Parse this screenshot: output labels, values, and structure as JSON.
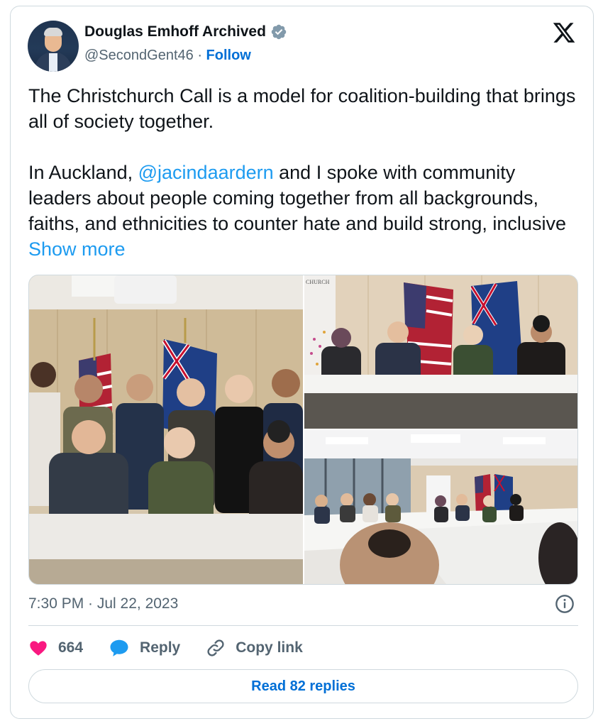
{
  "author": {
    "display_name": "Douglas Emhoff Archived",
    "handle": "@SecondGent46",
    "separator": "·",
    "follow_label": "Follow",
    "verified": true,
    "avatar": "profile-photo"
  },
  "brand_icon": "x-logo-icon",
  "tweet": {
    "paragraph_1": "The Christchurch Call is a model for coalition-building that brings all of society together.",
    "paragraph_2_before": "In Auckland, ",
    "mention": "@jacindaardern",
    "paragraph_2_after": " and I spoke with community leaders about people coming together from all backgrounds, faiths, and ethnicities to counter hate and build strong, inclusive ",
    "show_more": "Show more"
  },
  "media": {
    "photos": [
      {
        "kind": "group-photo"
      },
      {
        "kind": "panel-table-photo",
        "sign_text": "CHURCH"
      },
      {
        "kind": "conference-room-photo"
      }
    ]
  },
  "meta": {
    "timestamp": "7:30 PM · Jul 22, 2023",
    "info_icon": "info-icon"
  },
  "actions": {
    "like_count": "664",
    "reply_label": "Reply",
    "copy_link_label": "Copy link"
  },
  "read_replies_label": "Read 82 replies",
  "colors": {
    "link": "#1d9bf0",
    "follow": "#006fd6",
    "like": "#f91880",
    "reply_icon": "#1d9bf0",
    "border": "#cfd9de",
    "secondary_text": "#536471",
    "verified": "#829aab"
  }
}
